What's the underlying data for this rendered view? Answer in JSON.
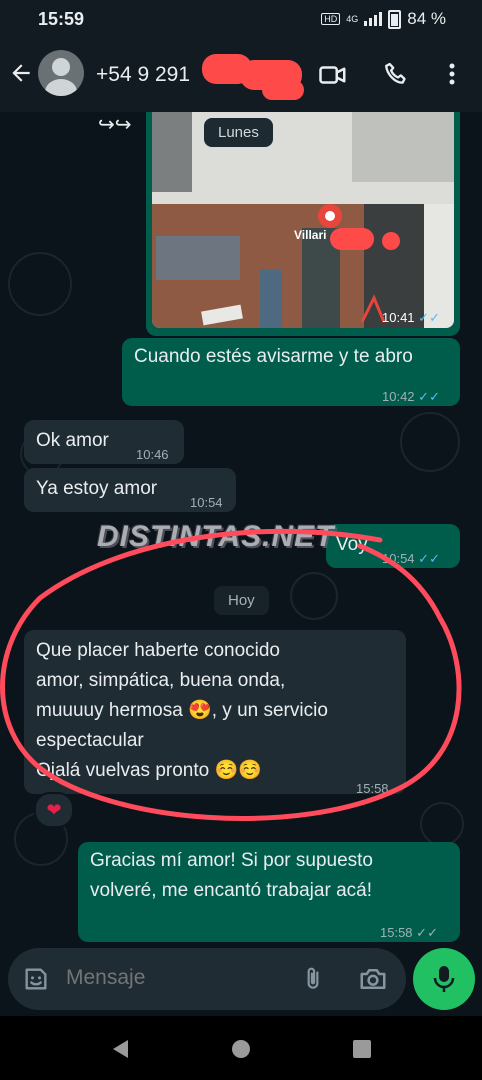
{
  "status_bar": {
    "time": "15:59",
    "hd": "HD",
    "network": "4G",
    "battery": "84 %"
  },
  "header": {
    "contact": "+54 9 291"
  },
  "watermark": "DISTINTAS.NET",
  "location_card": {
    "day": "Lunes",
    "place": "Villari",
    "time": "10:41"
  },
  "messages": [
    {
      "dir": "out",
      "text": "Cuando estés avisarme y te abro",
      "time": "10:42"
    },
    {
      "dir": "in",
      "text": "Ok amor",
      "time": "10:46"
    },
    {
      "dir": "in",
      "text": "Ya estoy amor",
      "time": "10:54"
    },
    {
      "dir": "out",
      "text": "Voy",
      "time": "10:54"
    },
    {
      "dir": "in",
      "lines": [
        "Que placer haberte conocido",
        "amor, simpática, buena onda,",
        "muuuuy hermosa 😍, y un servicio",
        "espectacular",
        "Ojalá vuelvas pronto ☺️☺️"
      ],
      "time": "15:58",
      "reaction": "❤"
    },
    {
      "dir": "out",
      "lines": [
        "Gracias mí amor! Si por supuesto",
        "volveré, me encantó trabajar acá!"
      ],
      "time": "15:58"
    }
  ],
  "today_label": "Hoy",
  "input": {
    "placeholder": "Mensaje"
  },
  "colors": {
    "outgoing": "#005c4b",
    "incoming": "#202c33",
    "mic": "#21c063",
    "highlight_circle": "#ff4b5c"
  }
}
